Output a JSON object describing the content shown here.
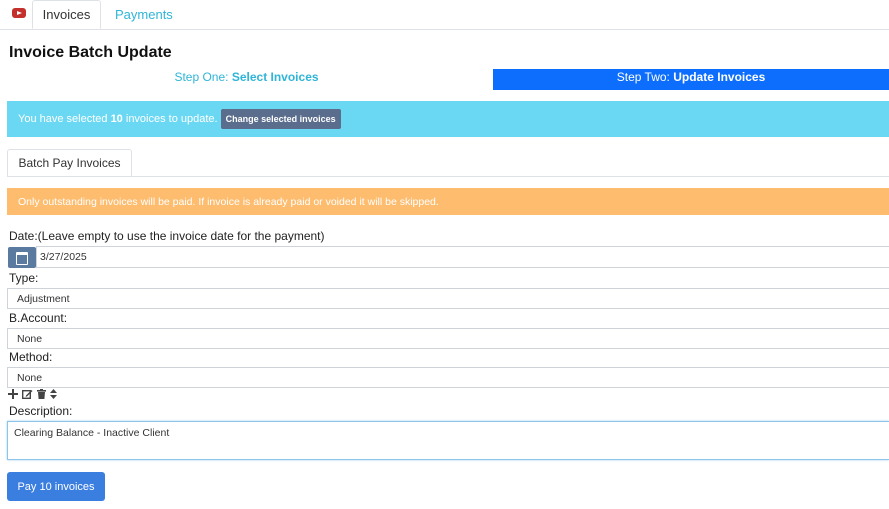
{
  "tabs": [
    {
      "label": "Invoices"
    },
    {
      "label": "Payments"
    }
  ],
  "page_title": "Invoice Batch Update",
  "steps": {
    "step1_prefix": "Step One:",
    "step1_name": "Select Invoices",
    "step2_prefix": "Step Two:",
    "step2_name": "Update Invoices"
  },
  "selection": {
    "prefix": "You have selected",
    "count": "10",
    "suffix": "invoices to update.",
    "change_button": "Change selected invoices"
  },
  "subtab_label": "Batch Pay Invoices",
  "warning_text": "Only outstanding invoices will be paid. If invoice is already paid or voided it will be skipped.",
  "form": {
    "date_label": "Date:(Leave empty to use the invoice date for the payment)",
    "date_value": "3/27/2025",
    "type_label": "Type:",
    "type_value": "Adjustment",
    "account_label": "B.Account:",
    "account_value": "None",
    "method_label": "Method:",
    "method_value": "None",
    "description_label": "Description:",
    "description_value": "Clearing Balance - Inactive Client"
  },
  "pay_button": "Pay 10 invoices",
  "colors": {
    "info": "#6ad8f2",
    "warning": "#fdbc6e",
    "primary": "#0d6efd",
    "link": "#2fb5d7"
  },
  "icons": [
    "youtube-icon",
    "calendar-icon",
    "plus-icon",
    "edit-icon",
    "trash-icon",
    "sort-icon"
  ]
}
